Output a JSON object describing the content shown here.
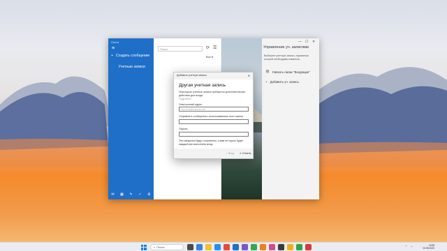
{
  "mail": {
    "app_title": "Почта",
    "new_message": "Создать сообщение",
    "accounts": "Учетные записи",
    "search_placeholder": "Поиск",
    "filter_label": "Все"
  },
  "manage_panel": {
    "title": "Управление уч. записями",
    "description": "Выберите учетную запись, параметры которой необходимо изменить.",
    "link_inboxes": "Связать папки \"Входящие\"",
    "add_account": "Добавить уч. запись"
  },
  "dialog": {
    "window_title": "Добавить учетную запись",
    "heading": "Другая учетная запись",
    "intro": "Некоторые учетные записи требуются дополнительные действия для входа.",
    "details_link": "Подробнее",
    "email_label": "Электронный адрес",
    "email_placeholder": "someone@example.com",
    "name_label": "Отправлять сообщения с использованием этого имени",
    "password_label": "Пароль",
    "note": "Эти сведения будут сохранены, и вам не нужно будет каждый раз выполнять вход.",
    "signin_button": "Вход",
    "cancel_button": "Отмена"
  },
  "taskbar": {
    "search_label": "Поиск",
    "time": "13:08",
    "date": "02.08.2023"
  }
}
